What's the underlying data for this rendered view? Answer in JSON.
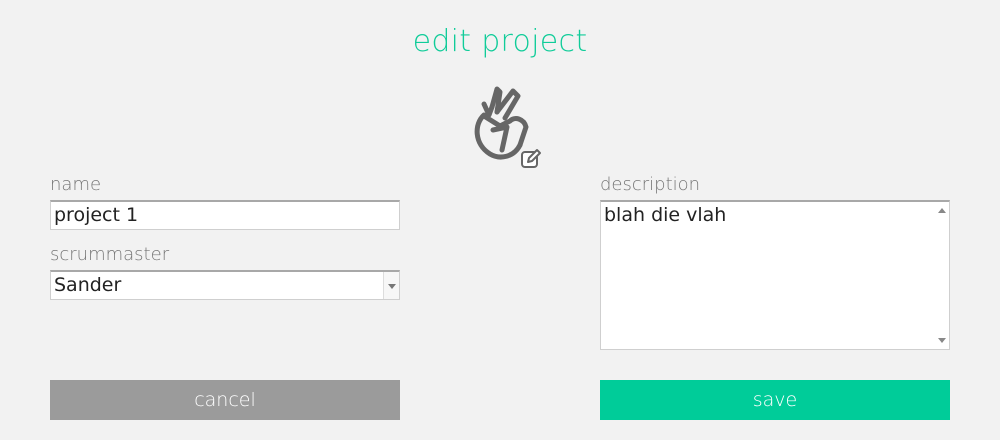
{
  "page": {
    "title": "edit project"
  },
  "form": {
    "name_label": "name",
    "name_value": "project 1",
    "scrummaster_label": "scrummaster",
    "scrummaster_value": "Sander",
    "description_label": "description",
    "description_value": "blah die vlah"
  },
  "buttons": {
    "cancel_label": "cancel",
    "save_label": "save"
  },
  "colors": {
    "accent": "#00cc99",
    "cancel": "#9b9b9b",
    "background": "#f2f2f2"
  },
  "icons": {
    "logo": "peace-hand-icon",
    "edit": "edit-pencil-icon"
  }
}
